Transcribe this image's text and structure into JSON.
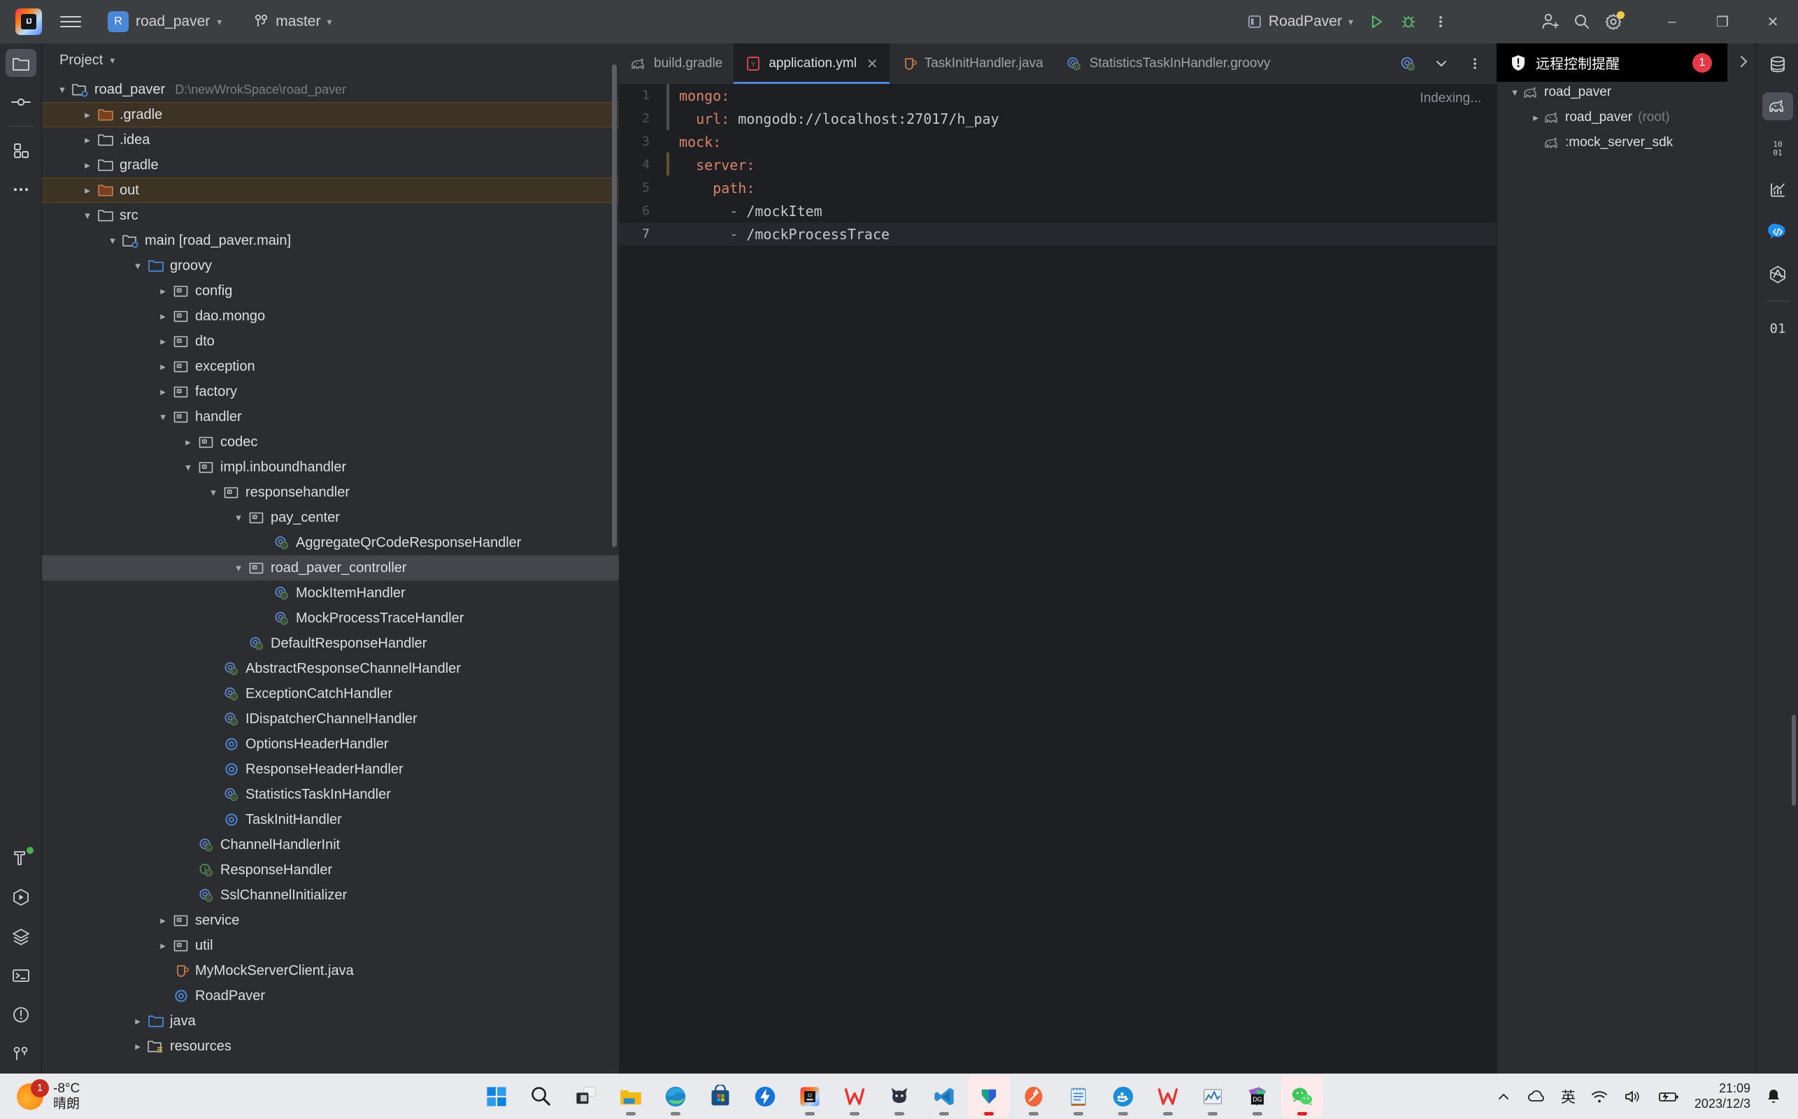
{
  "titlebar": {
    "logo_icon": "intellij-logo-icon",
    "logo_text": "IJ",
    "menu_icon": "hamburger-menu-icon",
    "project_badge": "R",
    "project_name": "road_paver",
    "branch_icon": "vcs-branch-icon",
    "branch_name": "master",
    "run_config_icon": "run-configuration-icon",
    "run_config_name": "RoadPaver",
    "run_icon": "run-icon",
    "debug_icon": "debug-icon",
    "more_icon": "more-vertical-icon",
    "account_icon": "account-add-icon",
    "search_icon": "search-icon",
    "settings_icon": "gear-icon",
    "minimize": "–",
    "maximize": "❐",
    "close": "✕"
  },
  "left_rail": {
    "top": [
      {
        "name": "project-tool-window",
        "icon": "folder-icon",
        "selected": true
      },
      {
        "name": "commit-tool-window",
        "icon": "commit-icon",
        "selected": false
      },
      {
        "name": "structure-tool-window",
        "icon": "structure-icon",
        "selected": false
      },
      {
        "name": "more-tool-windows",
        "icon": "ellipsis-icon",
        "selected": false
      }
    ],
    "bottom": [
      {
        "name": "build-tool-window",
        "icon": "hammer-icon",
        "selected": false,
        "status_dot": true
      },
      {
        "name": "run-tool-window",
        "icon": "run-hexagon-icon",
        "selected": false
      },
      {
        "name": "services-tool-window",
        "icon": "layers-icon",
        "selected": false
      },
      {
        "name": "terminal-tool-window",
        "icon": "terminal-icon",
        "selected": false
      },
      {
        "name": "problems-tool-window",
        "icon": "warning-circle-icon",
        "selected": false
      },
      {
        "name": "git-tool-window",
        "icon": "git-branch-icon",
        "selected": false
      }
    ]
  },
  "project_panel": {
    "title": "Project",
    "title_chevron": "⌄",
    "tree": [
      {
        "depth": 0,
        "arrow": "down",
        "icon": "module-folder-icon",
        "label": "road_paver",
        "path": "D:\\newWrokSpace\\road_paver",
        "state": "normal"
      },
      {
        "depth": 1,
        "arrow": "right",
        "icon": "folder-orange-icon",
        "label": ".gradle",
        "state": "orange"
      },
      {
        "depth": 1,
        "arrow": "right",
        "icon": "folder-icon",
        "label": ".idea",
        "state": "normal"
      },
      {
        "depth": 1,
        "arrow": "right",
        "icon": "folder-icon",
        "label": "gradle",
        "state": "normal"
      },
      {
        "depth": 1,
        "arrow": "right",
        "icon": "folder-orange-icon",
        "label": "out",
        "state": "orange"
      },
      {
        "depth": 1,
        "arrow": "down",
        "icon": "folder-icon",
        "label": "src",
        "state": "normal"
      },
      {
        "depth": 2,
        "arrow": "down",
        "icon": "module-folder-icon",
        "label": "main [road_paver.main]",
        "state": "normal"
      },
      {
        "depth": 3,
        "arrow": "down",
        "icon": "folder-blue-icon",
        "label": "groovy",
        "state": "normal"
      },
      {
        "depth": 4,
        "arrow": "right",
        "icon": "package-icon",
        "label": "config",
        "state": "normal"
      },
      {
        "depth": 4,
        "arrow": "right",
        "icon": "package-icon",
        "label": "dao.mongo",
        "state": "normal"
      },
      {
        "depth": 4,
        "arrow": "right",
        "icon": "package-icon",
        "label": "dto",
        "state": "normal"
      },
      {
        "depth": 4,
        "arrow": "right",
        "icon": "package-icon",
        "label": "exception",
        "state": "normal"
      },
      {
        "depth": 4,
        "arrow": "right",
        "icon": "package-icon",
        "label": "factory",
        "state": "normal"
      },
      {
        "depth": 4,
        "arrow": "down",
        "icon": "package-icon",
        "label": "handler",
        "state": "normal"
      },
      {
        "depth": 5,
        "arrow": "right",
        "icon": "package-icon",
        "label": "codec",
        "state": "normal"
      },
      {
        "depth": 5,
        "arrow": "down",
        "icon": "package-icon",
        "label": "impl.inboundhandler",
        "state": "normal"
      },
      {
        "depth": 6,
        "arrow": "down",
        "icon": "package-icon",
        "label": "responsehandler",
        "state": "normal"
      },
      {
        "depth": 7,
        "arrow": "down",
        "icon": "package-icon",
        "label": "pay_center",
        "state": "normal"
      },
      {
        "depth": 8,
        "arrow": "none",
        "icon": "groovy-class-icon",
        "label": "AggregateQrCodeResponseHandler",
        "state": "normal"
      },
      {
        "depth": 7,
        "arrow": "down",
        "icon": "package-icon",
        "label": "road_paver_controller",
        "state": "selected"
      },
      {
        "depth": 8,
        "arrow": "none",
        "icon": "groovy-class-icon",
        "label": "MockItemHandler",
        "state": "normal"
      },
      {
        "depth": 8,
        "arrow": "none",
        "icon": "groovy-class-icon",
        "label": "MockProcessTraceHandler",
        "state": "normal"
      },
      {
        "depth": 7,
        "arrow": "none",
        "icon": "groovy-class-icon",
        "label": "DefaultResponseHandler",
        "state": "normal"
      },
      {
        "depth": 6,
        "arrow": "none",
        "icon": "groovy-class-icon",
        "label": "AbstractResponseChannelHandler",
        "state": "normal"
      },
      {
        "depth": 6,
        "arrow": "none",
        "icon": "groovy-class-icon",
        "label": "ExceptionCatchHandler",
        "state": "normal"
      },
      {
        "depth": 6,
        "arrow": "none",
        "icon": "groovy-class-icon",
        "label": "IDispatcherChannelHandler",
        "state": "normal"
      },
      {
        "depth": 6,
        "arrow": "none",
        "icon": "java-class-icon",
        "label": "OptionsHeaderHandler",
        "state": "normal"
      },
      {
        "depth": 6,
        "arrow": "none",
        "icon": "java-class-icon",
        "label": "ResponseHeaderHandler",
        "state": "normal"
      },
      {
        "depth": 6,
        "arrow": "none",
        "icon": "groovy-class-icon",
        "label": "StatisticsTaskInHandler",
        "state": "normal"
      },
      {
        "depth": 6,
        "arrow": "none",
        "icon": "java-class-icon",
        "label": "TaskInitHandler",
        "state": "normal"
      },
      {
        "depth": 5,
        "arrow": "none",
        "icon": "groovy-class-icon",
        "label": "ChannelHandlerInit",
        "state": "normal"
      },
      {
        "depth": 5,
        "arrow": "none",
        "icon": "groovy-interface-icon",
        "label": "ResponseHandler",
        "state": "normal"
      },
      {
        "depth": 5,
        "arrow": "none",
        "icon": "groovy-class-icon",
        "label": "SslChannelInitializer",
        "state": "normal"
      },
      {
        "depth": 4,
        "arrow": "right",
        "icon": "package-icon",
        "label": "service",
        "state": "normal"
      },
      {
        "depth": 4,
        "arrow": "right",
        "icon": "package-icon",
        "label": "util",
        "state": "normal"
      },
      {
        "depth": 4,
        "arrow": "none",
        "icon": "java-file-icon",
        "label": "MyMockServerClient.java",
        "state": "normal"
      },
      {
        "depth": 4,
        "arrow": "none",
        "icon": "java-class-icon",
        "label": "RoadPaver",
        "state": "normal"
      },
      {
        "depth": 3,
        "arrow": "right",
        "icon": "folder-blue-icon",
        "label": "java",
        "state": "normal"
      },
      {
        "depth": 3,
        "arrow": "right",
        "icon": "resources-folder-icon",
        "label": "resources",
        "state": "normal"
      }
    ]
  },
  "editor": {
    "tabs": [
      {
        "label": "build.gradle",
        "icon": "gradle-icon",
        "active": false,
        "closable": false
      },
      {
        "label": "application.yml",
        "icon": "yaml-icon",
        "active": true,
        "closable": true
      },
      {
        "label": "TaskInitHandler.java",
        "icon": "java-file-icon",
        "active": false,
        "closable": false
      },
      {
        "label": "StatisticsTaskInHandler.groovy",
        "icon": "groovy-class-icon",
        "active": false,
        "closable": false
      }
    ],
    "tab_overflow_icon": "groovy-class-icon",
    "tab_list_icon": "chevron-down-icon",
    "tab_options_icon": "more-vertical-icon",
    "status_text": "Indexing...",
    "close_icon": "✕",
    "lines": [
      {
        "no": "1",
        "indent": 0,
        "key": "mongo:",
        "value": "",
        "dash": false,
        "current": false
      },
      {
        "no": "2",
        "indent": 2,
        "key": "url:",
        "value": " mongodb://localhost:27017/h_pay",
        "dash": false,
        "current": false
      },
      {
        "no": "3",
        "indent": 0,
        "key": "mock:",
        "value": "",
        "dash": false,
        "current": false
      },
      {
        "no": "4",
        "indent": 2,
        "key": "server:",
        "value": "",
        "dash": false,
        "current": false
      },
      {
        "no": "5",
        "indent": 4,
        "key": "path:",
        "value": "",
        "dash": false,
        "current": false
      },
      {
        "no": "6",
        "indent": 6,
        "key": "",
        "value": "/mockItem",
        "dash": true,
        "current": false
      },
      {
        "no": "7",
        "indent": 6,
        "key": "",
        "value": "/mockProcessTrace",
        "dash": true,
        "current": true
      }
    ]
  },
  "gradle_panel": {
    "toolbar": [
      {
        "name": "reload-gradle-button",
        "icon": "refresh-icon"
      },
      {
        "name": "add-gradle-project-button",
        "icon": "plus-icon"
      },
      {
        "name": "remove-gradle-project-button",
        "icon": "minus-icon"
      },
      {
        "name": "run-gradle-task-button",
        "icon": "execute-task-icon"
      },
      {
        "name": "expand-all-button",
        "icon": "expand-collapse-icon"
      },
      {
        "name": "collapse-all-button",
        "icon": "collapse-all-icon"
      },
      {
        "name": "gradle-settings-button",
        "icon": "folder-settings-icon"
      },
      {
        "name": "more-options-button",
        "icon": "chevron-right-icon"
      }
    ],
    "tree": [
      {
        "depth": 0,
        "arrow": "down",
        "label": "road_paver",
        "sub": ""
      },
      {
        "depth": 1,
        "arrow": "right",
        "label": "road_paver",
        "sub": "(root)"
      },
      {
        "depth": 1,
        "arrow": "none",
        "label": ":mock_server_sdk",
        "sub": ""
      }
    ]
  },
  "right_rail": [
    {
      "name": "database-tool-window",
      "icon": "database-icon",
      "selected": false
    },
    {
      "name": "gradle-tool-window",
      "icon": "gradle-elephant-icon",
      "selected": true
    },
    {
      "name": "bytecode-tool-window",
      "icon": "binary-1001-icon",
      "selected": false
    },
    {
      "name": "profiler-tool-window",
      "icon": "chart-icon",
      "selected": false
    },
    {
      "name": "code-with-me-tool-window",
      "icon": "code-bubble-icon",
      "selected": false
    },
    {
      "name": "maven-tool-window",
      "icon": "maven-icon",
      "selected": false
    },
    {
      "name": "binary-tool-window",
      "icon": "binary-01-icon",
      "selected": false
    }
  ],
  "notification": {
    "icon": "shield-alert-icon",
    "title": "远程控制提醒",
    "count": "1"
  },
  "taskbar": {
    "weather": {
      "icon": "sun-icon",
      "badge": "1",
      "temperature": "-8°C",
      "description": "晴朗"
    },
    "apps": [
      {
        "name": "start-button",
        "icon": "windows-icon",
        "running": false,
        "active": false
      },
      {
        "name": "search-taskbar-button",
        "icon": "search-icon",
        "running": false,
        "active": false
      },
      {
        "name": "task-view-button",
        "icon": "task-view-icon",
        "running": false,
        "active": false
      },
      {
        "name": "file-explorer-button",
        "icon": "file-explorer-icon",
        "running": true,
        "active": false
      },
      {
        "name": "edge-button",
        "icon": "edge-icon",
        "running": true,
        "active": false
      },
      {
        "name": "microsoft-store-button",
        "icon": "store-icon",
        "running": false,
        "active": false
      },
      {
        "name": "zoomit-button",
        "icon": "bolt-icon",
        "running": false,
        "active": false
      },
      {
        "name": "intellij-idea-button",
        "icon": "intellij-logo-icon",
        "running": true,
        "active": false
      },
      {
        "name": "wps-office-button",
        "icon": "wps-icon",
        "running": true,
        "active": false
      },
      {
        "name": "cat-app-button",
        "icon": "cat-icon",
        "running": true,
        "active": false
      },
      {
        "name": "vscode-button",
        "icon": "vscode-icon",
        "running": true,
        "active": false
      },
      {
        "name": "navicat-button",
        "icon": "navicat-icon",
        "running": true,
        "active": true
      },
      {
        "name": "postman-button",
        "icon": "postman-icon",
        "running": true,
        "active": false
      },
      {
        "name": "notepad-button",
        "icon": "notepad-icon",
        "running": true,
        "active": false
      },
      {
        "name": "docker-button",
        "icon": "docker-icon",
        "running": true,
        "active": false
      },
      {
        "name": "wps-writer-button",
        "icon": "wps-icon",
        "running": true,
        "active": false
      },
      {
        "name": "perfmon-button",
        "icon": "perfmon-icon",
        "running": true,
        "active": false
      },
      {
        "name": "datagrip-button",
        "icon": "datagrip-icon",
        "running": true,
        "active": false
      },
      {
        "name": "wechat-button",
        "icon": "wechat-icon",
        "running": true,
        "active": true
      }
    ],
    "tray": {
      "overflow_icon": "chevron-up-icon",
      "onedrive_icon": "cloud-icon",
      "ime_label": "英",
      "wifi_icon": "wifi-icon",
      "volume_icon": "volume-icon",
      "battery_icon": "battery-charging-icon",
      "time": "21:09",
      "date": "2023/12/3",
      "notification_icon": "bell-icon"
    }
  },
  "colors": {
    "accent": "#4a88d6",
    "selection": "#43454a",
    "orange_highlight": "#3d3325",
    "badge_red": "#e23a46",
    "titlebar_bg": "#3c3f41",
    "editor_bg": "#1e1f22",
    "panel_bg": "#2b2d30"
  }
}
